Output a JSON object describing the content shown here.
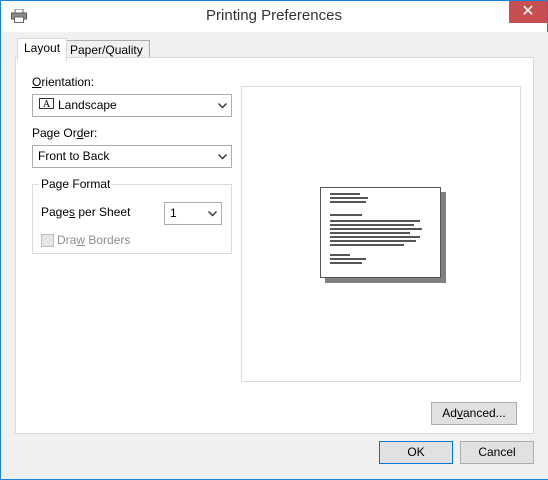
{
  "window": {
    "title": "Printing Preferences",
    "close_glyph": "✕",
    "icon": "printer-icon"
  },
  "tabs": [
    {
      "label": "Layout",
      "active": true
    },
    {
      "label": "Paper/Quality",
      "active": false
    }
  ],
  "layout": {
    "orientation": {
      "label_underlined": "O",
      "label_rest": "rientation:",
      "value": "Landscape",
      "icon": "landscape-page-icon"
    },
    "page_order": {
      "label_pre": "Page Or",
      "label_underlined": "d",
      "label_rest": "er:",
      "value": "Front to Back"
    },
    "page_format": {
      "legend": "Page Format",
      "pages_per_sheet": {
        "label_pre": "Page",
        "label_underlined": "s",
        "label_rest": " per Sheet",
        "value": "1"
      },
      "draw_borders": {
        "label_pre": "Dra",
        "label_underlined": "w",
        "label_rest": " Borders",
        "checked": false,
        "enabled": false
      }
    },
    "advanced_button": {
      "label_pre": "Ad",
      "label_underlined": "v",
      "label_rest": "anced..."
    }
  },
  "footer": {
    "ok_label": "OK",
    "cancel_label": "Cancel"
  },
  "colors": {
    "accent": "#0078d7",
    "close": "#c74f50"
  }
}
